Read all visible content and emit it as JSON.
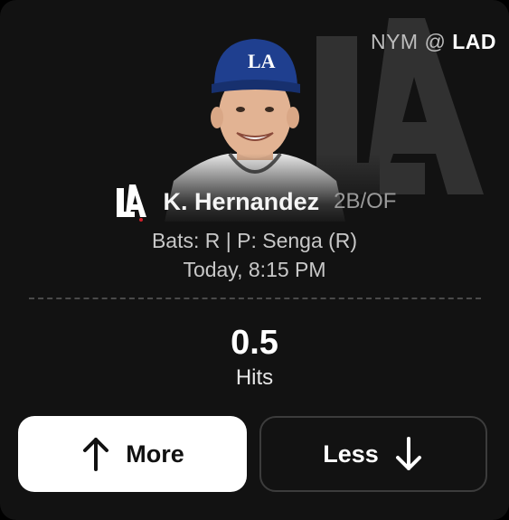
{
  "matchup": {
    "away": "NYM",
    "separator": "@",
    "home": "LAD"
  },
  "player": {
    "team_logo_text": "LA",
    "name": "K. Hernandez",
    "position": "2B/OF",
    "bats_line": "Bats: R | P: Senga (R)",
    "game_time": "Today, 8:15 PM"
  },
  "projection": {
    "value": "0.5",
    "stat": "Hits"
  },
  "buttons": {
    "more_label": "More",
    "less_label": "Less"
  },
  "colors": {
    "background": "#121212",
    "dodger_blue": "#1f3f8f",
    "more_button": "#ffffff"
  },
  "icons": {
    "more": "arrow-up-icon",
    "less": "arrow-down-icon",
    "team": "dodgers-la-logo-icon"
  }
}
